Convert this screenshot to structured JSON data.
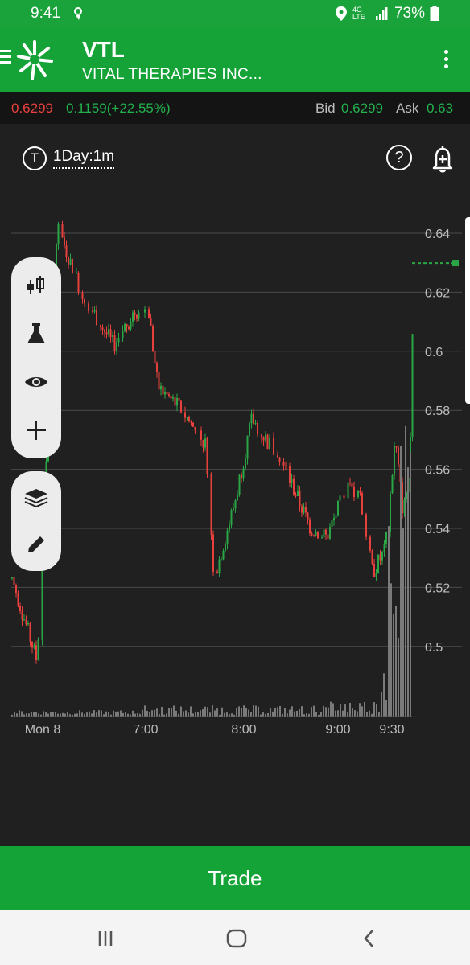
{
  "status_bar": {
    "time": "9:41",
    "network": "4G LTE",
    "battery": "73%"
  },
  "header": {
    "ticker": "VTL",
    "company": "VITAL THERAPIES INC...",
    "menu_icon": "hamburger-icon",
    "logo_icon": "sunburst-logo-icon",
    "more_icon": "kebab-icon"
  },
  "quote": {
    "last": "0.6299",
    "change": "0.1159(+22.55%)",
    "bid_label": "Bid",
    "bid": "0.6299",
    "ask_label": "Ask",
    "ask": "0.63"
  },
  "chart_header": {
    "t_label": "T",
    "timeframe": "1Day:1m",
    "help_label": "?"
  },
  "chart_data": {
    "type": "candlestick",
    "x_ticks": [
      "Mon 8",
      "7:00",
      "8:00",
      "9:00",
      "9:30"
    ],
    "y_ticks": [
      "0.64",
      "0.62",
      "0.6",
      "0.58",
      "0.56",
      "0.54",
      "0.52",
      "0.5"
    ],
    "ylim": [
      0.48,
      0.65
    ],
    "grid": true,
    "last_price": 0.6299,
    "colors": {
      "up": "#2aa646",
      "down": "#e8413d",
      "volume": "#7a7a7a",
      "grid": "#4a4a4a"
    }
  },
  "toolbar": {
    "tools": [
      "candlestick-icon",
      "flask-icon",
      "eye-icon",
      "crosshair-icon",
      "layers-icon",
      "pencil-icon"
    ]
  },
  "trade_button": {
    "label": "Trade"
  },
  "nav": {
    "recents_icon": "recents-icon",
    "home_icon": "home-icon",
    "back_icon": "back-icon"
  }
}
